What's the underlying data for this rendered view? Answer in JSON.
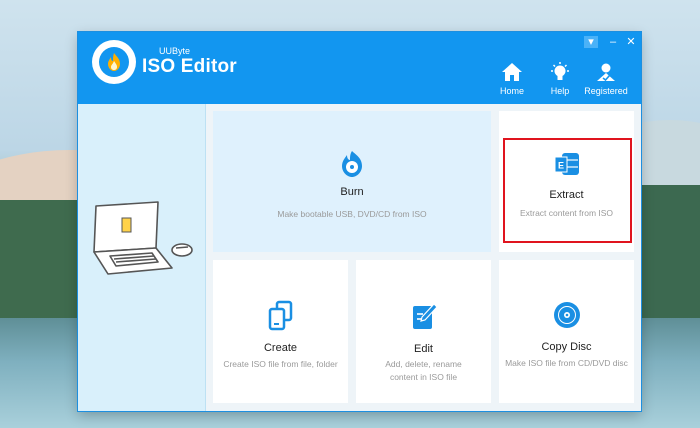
{
  "window": {
    "brand_small": "UUByte",
    "brand_title": "ISO Editor",
    "controls": {
      "menu": "▾",
      "minimize": "–",
      "close": "✕"
    }
  },
  "nav": {
    "home": "Home",
    "help": "Help",
    "registered": "Registered"
  },
  "cards": {
    "burn": {
      "title": "Burn",
      "desc": "Make bootable USB, DVD/CD from ISO"
    },
    "extract": {
      "title": "Extract",
      "desc": "Extract content from ISO"
    },
    "create": {
      "title": "Create",
      "desc": "Create ISO file from file, folder"
    },
    "edit": {
      "title": "Edit",
      "desc_line1": "Add, delete, rename",
      "desc_line2": "content in ISO file"
    },
    "copy": {
      "title": "Copy Disc",
      "desc": "Make ISO file from CD/DVD disc"
    }
  },
  "colors": {
    "titlebar": "#1296f0",
    "accent_icon": "#1a8fe3",
    "highlight": "#e0141e"
  }
}
